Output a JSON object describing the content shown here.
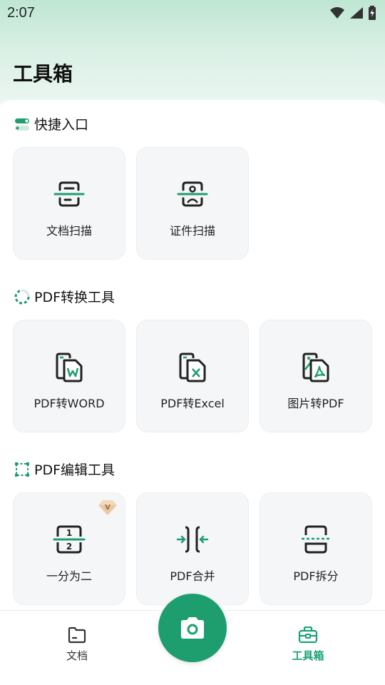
{
  "status_bar": {
    "time": "2:07"
  },
  "page": {
    "title": "工具箱"
  },
  "sections": {
    "quick": {
      "title": "快捷入口",
      "items": [
        {
          "label": "文档扫描",
          "icon": "document-scan-icon"
        },
        {
          "label": "证件扫描",
          "icon": "id-scan-icon"
        }
      ]
    },
    "convert": {
      "title": "PDF转换工具",
      "items": [
        {
          "label": "PDF转WORD",
          "icon": "pdf-to-word-icon"
        },
        {
          "label": "PDF转Excel",
          "icon": "pdf-to-excel-icon"
        },
        {
          "label": "图片转PDF",
          "icon": "image-to-pdf-icon"
        }
      ]
    },
    "edit": {
      "title": "PDF编辑工具",
      "items": [
        {
          "label": "一分为二",
          "icon": "split-in-two-icon",
          "badge": "V"
        },
        {
          "label": "PDF合并",
          "icon": "pdf-merge-icon"
        },
        {
          "label": "PDF拆分",
          "icon": "pdf-split-icon"
        }
      ]
    }
  },
  "bottom_nav": {
    "documents": {
      "label": "文档",
      "icon": "folder-icon"
    },
    "tools": {
      "label": "工具箱",
      "icon": "toolbox-icon",
      "active": true
    },
    "camera": {
      "icon": "camera-icon"
    }
  },
  "colors": {
    "accent": "#1e9e6e",
    "active_tab": "#1aa372",
    "card_bg": "#f5f6f8"
  }
}
